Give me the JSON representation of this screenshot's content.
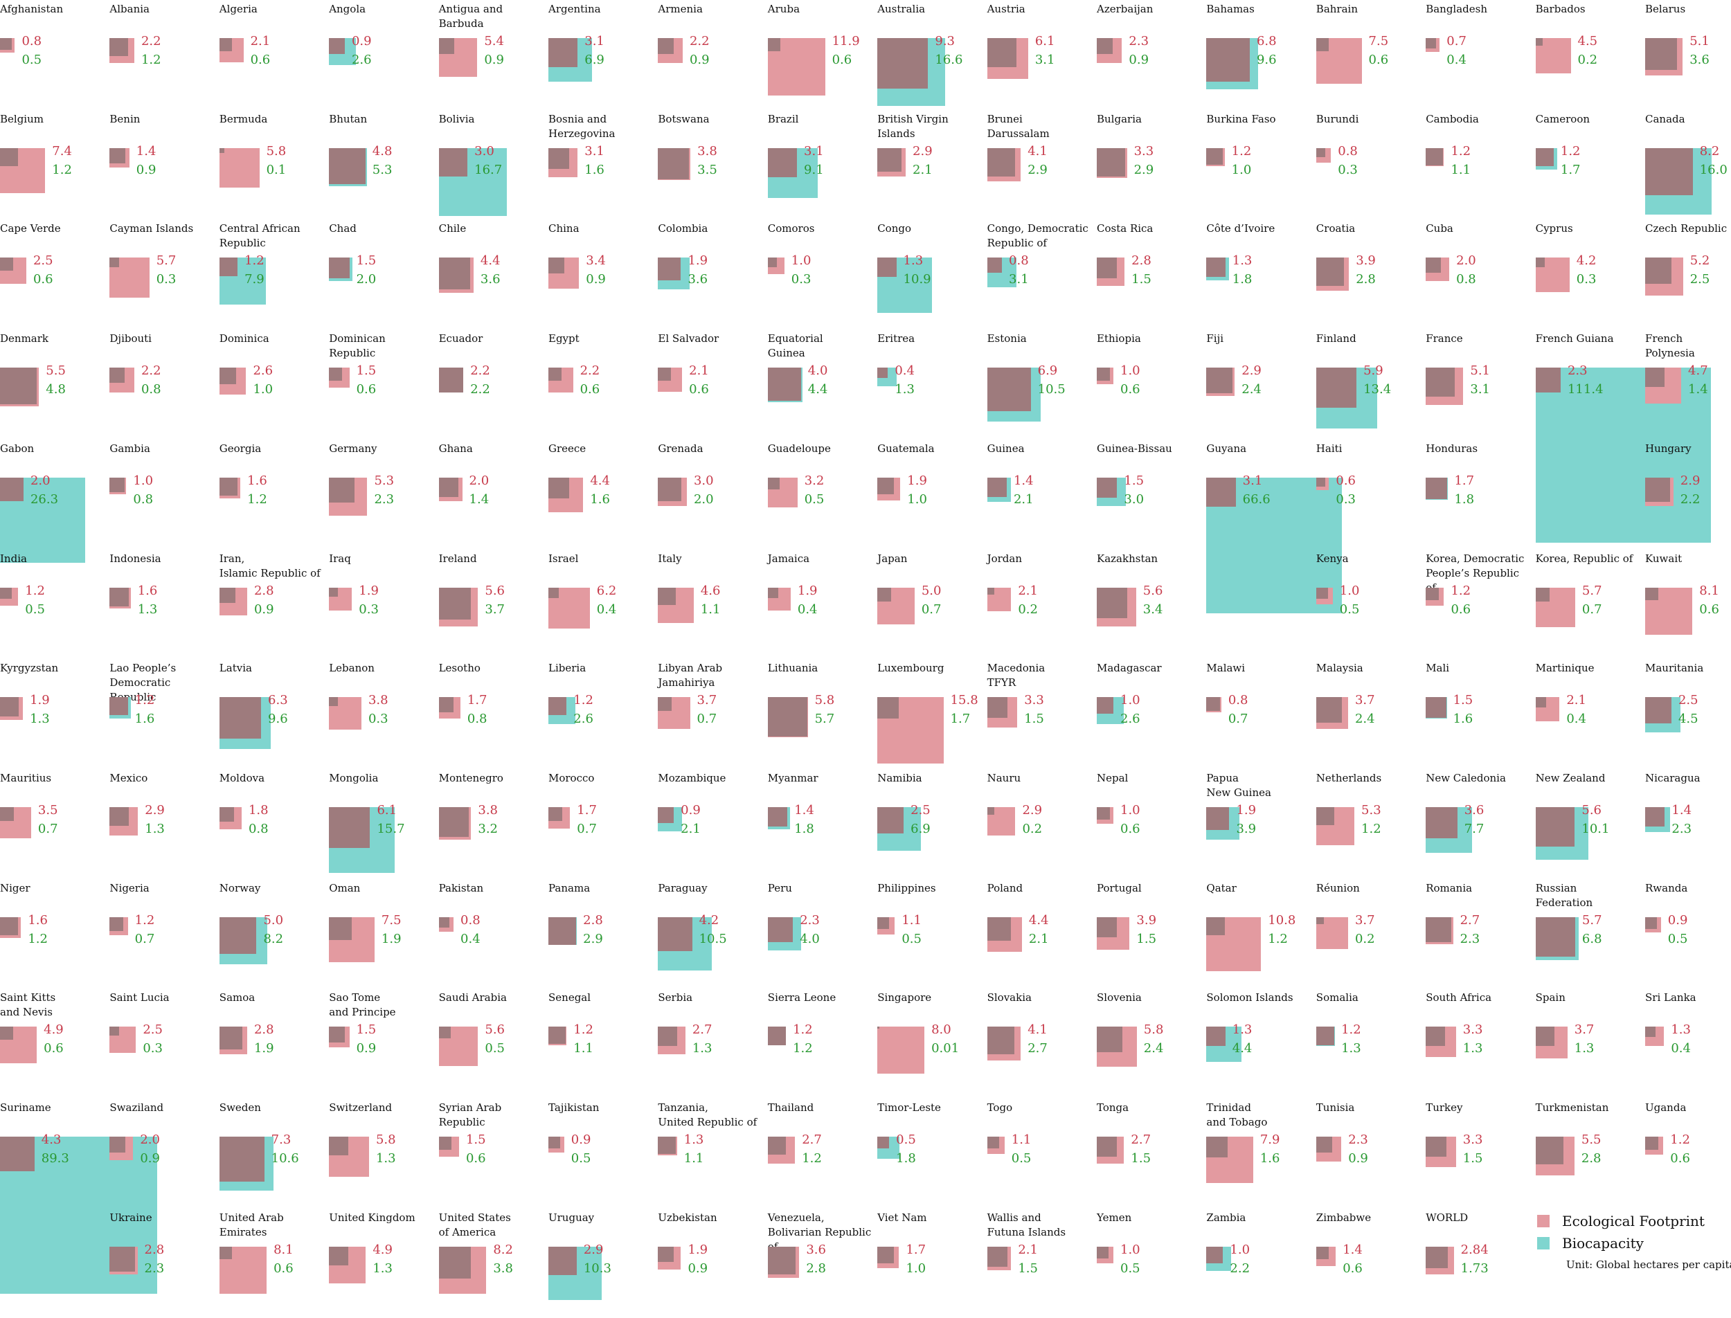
{
  "colors": {
    "ecological_footprint": "#e39aa0",
    "biocapacity": "#7fd5cf",
    "overlap": "#9e7b7d",
    "ef_text": "#c73b4b",
    "bio_text": "#2a9932"
  },
  "legend": {
    "ef_label": "Ecological Footprint",
    "bio_label": "Biocapacity",
    "unit": "Unit: Global hectares per capita"
  },
  "chart_data": {
    "type": "small-multiples (nested area squares)",
    "title": "",
    "unit": "Global hectares per capita",
    "series": [
      {
        "name": "Ecological Footprint"
      },
      {
        "name": "Biocapacity"
      }
    ],
    "countries": [
      {
        "name": "Afghanistan",
        "ef": "0.8",
        "bio": "0.5"
      },
      {
        "name": "Albania",
        "ef": "2.2",
        "bio": "1.2"
      },
      {
        "name": "Algeria",
        "ef": "2.1",
        "bio": "0.6"
      },
      {
        "name": "Angola",
        "ef": "0.9",
        "bio": "2.6"
      },
      {
        "name": "Antigua and\nBarbuda",
        "ef": "5.4",
        "bio": "0.9"
      },
      {
        "name": "Argentina",
        "ef": "3.1",
        "bio": "6.9"
      },
      {
        "name": "Armenia",
        "ef": "2.2",
        "bio": "0.9"
      },
      {
        "name": "Aruba",
        "ef": "11.9",
        "bio": "0.6"
      },
      {
        "name": "Australia",
        "ef": "9.3",
        "bio": "16.6"
      },
      {
        "name": "Austria",
        "ef": "6.1",
        "bio": "3.1"
      },
      {
        "name": "Azerbaijan",
        "ef": "2.3",
        "bio": "0.9"
      },
      {
        "name": "Bahamas",
        "ef": "6.8",
        "bio": "9.6"
      },
      {
        "name": "Bahrain",
        "ef": "7.5",
        "bio": "0.6"
      },
      {
        "name": "Bangladesh",
        "ef": "0.7",
        "bio": "0.4"
      },
      {
        "name": "Barbados",
        "ef": "4.5",
        "bio": "0.2"
      },
      {
        "name": "Belarus",
        "ef": "5.1",
        "bio": "3.6"
      },
      {
        "name": "Belgium",
        "ef": "7.4",
        "bio": "1.2"
      },
      {
        "name": "Benin",
        "ef": "1.4",
        "bio": "0.9"
      },
      {
        "name": "Bermuda",
        "ef": "5.8",
        "bio": "0.1"
      },
      {
        "name": "Bhutan",
        "ef": "4.8",
        "bio": "5.3"
      },
      {
        "name": "Bolivia",
        "ef": "3.0",
        "bio": "16.7"
      },
      {
        "name": "Bosnia and\nHerzegovina",
        "ef": "3.1",
        "bio": "1.6"
      },
      {
        "name": "Botswana",
        "ef": "3.8",
        "bio": "3.5"
      },
      {
        "name": "Brazil",
        "ef": "3.1",
        "bio": "9.1"
      },
      {
        "name": "British Virgin\nIslands",
        "ef": "2.9",
        "bio": "2.1"
      },
      {
        "name": "Brunei\nDarussalam",
        "ef": "4.1",
        "bio": "2.9"
      },
      {
        "name": "Bulgaria",
        "ef": "3.3",
        "bio": "2.9"
      },
      {
        "name": "Burkina Faso",
        "ef": "1.2",
        "bio": "1.0"
      },
      {
        "name": "Burundi",
        "ef": "0.8",
        "bio": "0.3"
      },
      {
        "name": "Cambodia",
        "ef": "1.2",
        "bio": "1.1"
      },
      {
        "name": "Cameroon",
        "ef": "1.2",
        "bio": "1.7"
      },
      {
        "name": "Canada",
        "ef": "8.2",
        "bio": "16.0"
      },
      {
        "name": "Cape Verde",
        "ef": "2.5",
        "bio": "0.6"
      },
      {
        "name": "Cayman Islands",
        "ef": "5.7",
        "bio": "0.3"
      },
      {
        "name": "Central African\nRepublic",
        "ef": "1.2",
        "bio": "7.9"
      },
      {
        "name": "Chad",
        "ef": "1.5",
        "bio": "2.0"
      },
      {
        "name": "Chile",
        "ef": "4.4",
        "bio": "3.6"
      },
      {
        "name": "China",
        "ef": "3.4",
        "bio": "0.9"
      },
      {
        "name": "Colombia",
        "ef": "1.9",
        "bio": "3.6"
      },
      {
        "name": "Comoros",
        "ef": "1.0",
        "bio": "0.3"
      },
      {
        "name": "Congo",
        "ef": "1.3",
        "bio": "10.9"
      },
      {
        "name": "Congo, Democratic\nRepublic of",
        "ef": "0.8",
        "bio": "3.1"
      },
      {
        "name": "Costa Rica",
        "ef": "2.8",
        "bio": "1.5"
      },
      {
        "name": "Côte d’Ivoire",
        "ef": "1.3",
        "bio": "1.8"
      },
      {
        "name": "Croatia",
        "ef": "3.9",
        "bio": "2.8"
      },
      {
        "name": "Cuba",
        "ef": "2.0",
        "bio": "0.8"
      },
      {
        "name": "Cyprus",
        "ef": "4.2",
        "bio": "0.3"
      },
      {
        "name": "Czech Republic",
        "ef": "5.2",
        "bio": "2.5"
      },
      {
        "name": "Denmark",
        "ef": "5.5",
        "bio": "4.8"
      },
      {
        "name": "Djibouti",
        "ef": "2.2",
        "bio": "0.8"
      },
      {
        "name": "Dominica",
        "ef": "2.6",
        "bio": "1.0"
      },
      {
        "name": "Dominican\nRepublic",
        "ef": "1.5",
        "bio": "0.6"
      },
      {
        "name": "Ecuador",
        "ef": "2.2",
        "bio": "2.2"
      },
      {
        "name": "Egypt",
        "ef": "2.2",
        "bio": "0.6"
      },
      {
        "name": "El Salvador",
        "ef": "2.1",
        "bio": "0.6"
      },
      {
        "name": "Equatorial\nGuinea",
        "ef": "4.0",
        "bio": "4.4"
      },
      {
        "name": "Eritrea",
        "ef": "0.4",
        "bio": "1.3"
      },
      {
        "name": "Estonia",
        "ef": "6.9",
        "bio": "10.5"
      },
      {
        "name": "Ethiopia",
        "ef": "1.0",
        "bio": "0.6"
      },
      {
        "name": "Fiji",
        "ef": "2.9",
        "bio": "2.4"
      },
      {
        "name": "Finland",
        "ef": "5.9",
        "bio": "13.4"
      },
      {
        "name": "France",
        "ef": "5.1",
        "bio": "3.1"
      },
      {
        "name": "French Guiana",
        "ef": "2.3",
        "bio": "111.4"
      },
      {
        "name": "French\nPolynesia",
        "ef": "4.7",
        "bio": "1.4"
      },
      {
        "name": "Gabon",
        "ef": "2.0",
        "bio": "26.3"
      },
      {
        "name": "Gambia",
        "ef": "1.0",
        "bio": "0.8"
      },
      {
        "name": "Georgia",
        "ef": "1.6",
        "bio": "1.2"
      },
      {
        "name": "Germany",
        "ef": "5.3",
        "bio": "2.3"
      },
      {
        "name": "Ghana",
        "ef": "2.0",
        "bio": "1.4"
      },
      {
        "name": "Greece",
        "ef": "4.4",
        "bio": "1.6"
      },
      {
        "name": "Grenada",
        "ef": "3.0",
        "bio": "2.0"
      },
      {
        "name": "Guadeloupe",
        "ef": "3.2",
        "bio": "0.5"
      },
      {
        "name": "Guatemala",
        "ef": "1.9",
        "bio": "1.0"
      },
      {
        "name": "Guinea",
        "ef": "1.4",
        "bio": "2.1"
      },
      {
        "name": "Guinea-Bissau",
        "ef": "1.5",
        "bio": "3.0"
      },
      {
        "name": "Guyana",
        "ef": "3.1",
        "bio": "66.6"
      },
      {
        "name": "Haiti",
        "ef": "0.6",
        "bio": "0.3"
      },
      {
        "name": "Honduras",
        "ef": "1.7",
        "bio": "1.8"
      },
      {
        "name": "",
        "ef": "",
        "bio": ""
      },
      {
        "name": "Hungary",
        "ef": "2.9",
        "bio": "2.2"
      },
      {
        "name": "India",
        "ef": "1.2",
        "bio": "0.5"
      },
      {
        "name": "Indonesia",
        "ef": "1.6",
        "bio": "1.3"
      },
      {
        "name": "Iran,\nIslamic Republic of",
        "ef": "2.8",
        "bio": "0.9"
      },
      {
        "name": "Iraq",
        "ef": "1.9",
        "bio": "0.3"
      },
      {
        "name": "Ireland",
        "ef": "5.6",
        "bio": "3.7"
      },
      {
        "name": "Israel",
        "ef": "6.2",
        "bio": "0.4"
      },
      {
        "name": "Italy",
        "ef": "4.6",
        "bio": "1.1"
      },
      {
        "name": "Jamaica",
        "ef": "1.9",
        "bio": "0.4"
      },
      {
        "name": "Japan",
        "ef": "5.0",
        "bio": "0.7"
      },
      {
        "name": "Jordan",
        "ef": "2.1",
        "bio": "0.2"
      },
      {
        "name": "Kazakhstan",
        "ef": "5.6",
        "bio": "3.4"
      },
      {
        "name": "",
        "ef": "",
        "bio": ""
      },
      {
        "name": "Kenya",
        "ef": "1.0",
        "bio": "0.5"
      },
      {
        "name": "Korea, Democratic\nPeople’s Republic of",
        "ef": "1.2",
        "bio": "0.6"
      },
      {
        "name": "Korea, Republic of",
        "ef": "5.7",
        "bio": "0.7"
      },
      {
        "name": "Kuwait",
        "ef": "8.1",
        "bio": "0.6"
      },
      {
        "name": "Kyrgyzstan",
        "ef": "1.9",
        "bio": "1.3"
      },
      {
        "name": "Lao People’s\nDemocratic Republic",
        "ef": "1.2",
        "bio": "1.6"
      },
      {
        "name": "Latvia",
        "ef": "6.3",
        "bio": "9.6"
      },
      {
        "name": "Lebanon",
        "ef": "3.8",
        "bio": "0.3"
      },
      {
        "name": "Lesotho",
        "ef": "1.7",
        "bio": "0.8"
      },
      {
        "name": "Liberia",
        "ef": "1.2",
        "bio": "2.6"
      },
      {
        "name": "Libyan Arab\nJamahiriya",
        "ef": "3.7",
        "bio": "0.7"
      },
      {
        "name": "Lithuania",
        "ef": "5.8",
        "bio": "5.7"
      },
      {
        "name": "Luxembourg",
        "ef": "15.8",
        "bio": "1.7"
      },
      {
        "name": "Macedonia\nTFYR",
        "ef": "3.3",
        "bio": "1.5"
      },
      {
        "name": "Madagascar",
        "ef": "1.0",
        "bio": "2.6"
      },
      {
        "name": "Malawi",
        "ef": "0.8",
        "bio": "0.7"
      },
      {
        "name": "Malaysia",
        "ef": "3.7",
        "bio": "2.4"
      },
      {
        "name": "Mali",
        "ef": "1.5",
        "bio": "1.6"
      },
      {
        "name": "Martinique",
        "ef": "2.1",
        "bio": "0.4"
      },
      {
        "name": "Mauritania",
        "ef": "2.5",
        "bio": "4.5"
      },
      {
        "name": "Mauritius",
        "ef": "3.5",
        "bio": "0.7"
      },
      {
        "name": "Mexico",
        "ef": "2.9",
        "bio": "1.3"
      },
      {
        "name": "Moldova",
        "ef": "1.8",
        "bio": "0.8"
      },
      {
        "name": "Mongolia",
        "ef": "6.1",
        "bio": "15.7"
      },
      {
        "name": "Montenegro",
        "ef": "3.8",
        "bio": "3.2"
      },
      {
        "name": "Morocco",
        "ef": "1.7",
        "bio": "0.7"
      },
      {
        "name": "Mozambique",
        "ef": "0.9",
        "bio": "2.1"
      },
      {
        "name": "Myanmar",
        "ef": "1.4",
        "bio": "1.8"
      },
      {
        "name": "Namibia",
        "ef": "2.5",
        "bio": "6.9"
      },
      {
        "name": "Nauru",
        "ef": "2.9",
        "bio": "0.2"
      },
      {
        "name": "Nepal",
        "ef": "1.0",
        "bio": "0.6"
      },
      {
        "name": "Papua\nNew Guinea",
        "ef": "1.9",
        "bio": "3.9"
      },
      {
        "name": "Netherlands",
        "ef": "5.3",
        "bio": "1.2"
      },
      {
        "name": "New Caledonia",
        "ef": "3.6",
        "bio": "7.7"
      },
      {
        "name": "New Zealand",
        "ef": "5.6",
        "bio": "10.1"
      },
      {
        "name": "Nicaragua",
        "ef": "1.4",
        "bio": "2.3"
      },
      {
        "name": "Niger",
        "ef": "1.6",
        "bio": "1.2"
      },
      {
        "name": "Nigeria",
        "ef": "1.2",
        "bio": "0.7"
      },
      {
        "name": "Norway",
        "ef": "5.0",
        "bio": "8.2"
      },
      {
        "name": "Oman",
        "ef": "7.5",
        "bio": "1.9"
      },
      {
        "name": "Pakistan",
        "ef": "0.8",
        "bio": "0.4"
      },
      {
        "name": "Panama",
        "ef": "2.8",
        "bio": "2.9"
      },
      {
        "name": "Paraguay",
        "ef": "4.2",
        "bio": "10.5"
      },
      {
        "name": "Peru",
        "ef": "2.3",
        "bio": "4.0"
      },
      {
        "name": "Philippines",
        "ef": "1.1",
        "bio": "0.5"
      },
      {
        "name": "Poland",
        "ef": "4.4",
        "bio": "2.1"
      },
      {
        "name": "Portugal",
        "ef": "3.9",
        "bio": "1.5"
      },
      {
        "name": "Qatar",
        "ef": "10.8",
        "bio": "1.2"
      },
      {
        "name": "Réunion",
        "ef": "3.7",
        "bio": "0.2"
      },
      {
        "name": "Romania",
        "ef": "2.7",
        "bio": "2.3"
      },
      {
        "name": "Russian\nFederation",
        "ef": "5.7",
        "bio": "6.8"
      },
      {
        "name": "Rwanda",
        "ef": "0.9",
        "bio": "0.5"
      },
      {
        "name": "Saint Kitts\nand Nevis",
        "ef": "4.9",
        "bio": "0.6"
      },
      {
        "name": "Saint Lucia",
        "ef": "2.5",
        "bio": "0.3"
      },
      {
        "name": "Samoa",
        "ef": "2.8",
        "bio": "1.9"
      },
      {
        "name": "Sao Tome\nand Principe",
        "ef": "1.5",
        "bio": "0.9"
      },
      {
        "name": "Saudi Arabia",
        "ef": "5.6",
        "bio": "0.5"
      },
      {
        "name": "Senegal",
        "ef": "1.2",
        "bio": "1.1"
      },
      {
        "name": "Serbia",
        "ef": "2.7",
        "bio": "1.3"
      },
      {
        "name": "Sierra Leone",
        "ef": "1.2",
        "bio": "1.2"
      },
      {
        "name": "Singapore",
        "ef": "8.0",
        "bio": "0.01"
      },
      {
        "name": "Slovakia",
        "ef": "4.1",
        "bio": "2.7"
      },
      {
        "name": "Slovenia",
        "ef": "5.8",
        "bio": "2.4"
      },
      {
        "name": "Solomon Islands",
        "ef": "1.3",
        "bio": "4.4"
      },
      {
        "name": "Somalia",
        "ef": "1.2",
        "bio": "1.3"
      },
      {
        "name": "South Africa",
        "ef": "3.3",
        "bio": "1.3"
      },
      {
        "name": "Spain",
        "ef": "3.7",
        "bio": "1.3"
      },
      {
        "name": "Sri Lanka",
        "ef": "1.3",
        "bio": "0.4"
      },
      {
        "name": "Suriname",
        "ef": "4.3",
        "bio": "89.3"
      },
      {
        "name": "Swaziland",
        "ef": "2.0",
        "bio": "0.9"
      },
      {
        "name": "Sweden",
        "ef": "7.3",
        "bio": "10.6"
      },
      {
        "name": "Switzerland",
        "ef": "5.8",
        "bio": "1.3"
      },
      {
        "name": "Syrian Arab\nRepublic",
        "ef": "1.5",
        "bio": "0.6"
      },
      {
        "name": "Tajikistan",
        "ef": "0.9",
        "bio": "0.5"
      },
      {
        "name": "Tanzania,\nUnited Republic of",
        "ef": "1.3",
        "bio": "1.1"
      },
      {
        "name": "Thailand",
        "ef": "2.7",
        "bio": "1.2"
      },
      {
        "name": "Timor-Leste",
        "ef": "0.5",
        "bio": "1.8"
      },
      {
        "name": "Togo",
        "ef": "1.1",
        "bio": "0.5"
      },
      {
        "name": "Tonga",
        "ef": "2.7",
        "bio": "1.5"
      },
      {
        "name": "Trinidad\nand Tobago",
        "ef": "7.9",
        "bio": "1.6"
      },
      {
        "name": "Tunisia",
        "ef": "2.3",
        "bio": "0.9"
      },
      {
        "name": "Turkey",
        "ef": "3.3",
        "bio": "1.5"
      },
      {
        "name": "Turkmenistan",
        "ef": "5.5",
        "bio": "2.8"
      },
      {
        "name": "Uganda",
        "ef": "1.2",
        "bio": "0.6"
      },
      {
        "name": "",
        "ef": "",
        "bio": ""
      },
      {
        "name": "Ukraine",
        "ef": "2.8",
        "bio": "2.3"
      },
      {
        "name": "United Arab\nEmirates",
        "ef": "8.1",
        "bio": "0.6"
      },
      {
        "name": "United Kingdom",
        "ef": "4.9",
        "bio": "1.3"
      },
      {
        "name": "United States\nof America",
        "ef": "8.2",
        "bio": "3.8"
      },
      {
        "name": "Uruguay",
        "ef": "2.9",
        "bio": "10.3"
      },
      {
        "name": "Uzbekistan",
        "ef": "1.9",
        "bio": "0.9"
      },
      {
        "name": "Venezuela,\nBolivarian Republic of",
        "ef": "3.6",
        "bio": "2.8"
      },
      {
        "name": "Viet Nam",
        "ef": "1.7",
        "bio": "1.0"
      },
      {
        "name": "Wallis and\nFutuna Islands",
        "ef": "2.1",
        "bio": "1.5"
      },
      {
        "name": "Yemen",
        "ef": "1.0",
        "bio": "0.5"
      },
      {
        "name": "Zambia",
        "ef": "1.0",
        "bio": "2.2"
      },
      {
        "name": "Zimbabwe",
        "ef": "1.4",
        "bio": "0.6"
      },
      {
        "name": "WORLD",
        "ef": "2.84",
        "bio": "1.73"
      }
    ]
  }
}
